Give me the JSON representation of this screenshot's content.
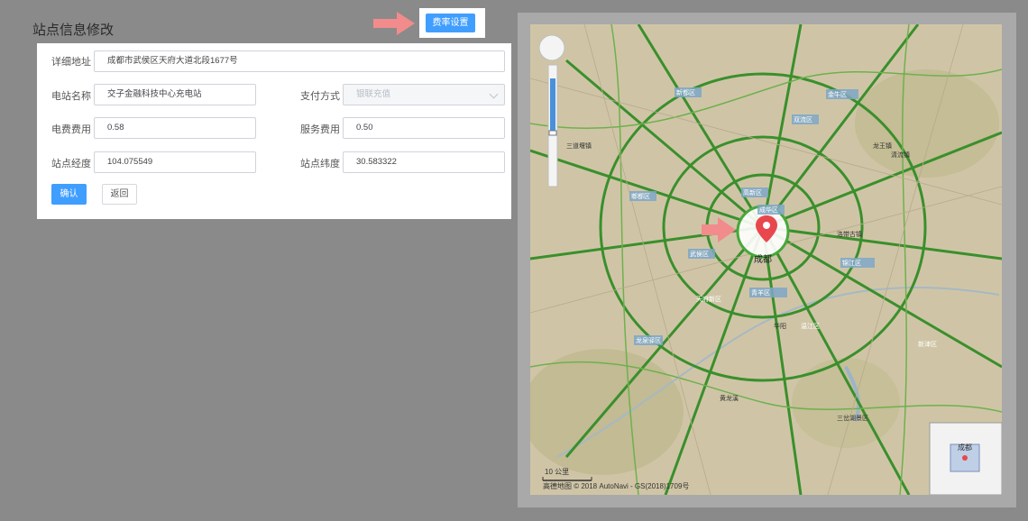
{
  "page": {
    "title": "站点信息修改"
  },
  "toolbar": {
    "rate_button_label": "费率设置"
  },
  "form": {
    "address": {
      "label": "详细地址",
      "value": "成都市武侯区天府大道北段1677号"
    },
    "station_name": {
      "label": "电站名称",
      "value": "交子金融科技中心充电站"
    },
    "payment": {
      "label": "支付方式",
      "value": "银联充值"
    },
    "electricity_fee": {
      "label": "电费费用",
      "value": "0.58"
    },
    "service_fee": {
      "label": "服务费用",
      "value": "0.50"
    },
    "longitude": {
      "label": "站点经度",
      "value": "104.075549"
    },
    "latitude": {
      "label": "站点纬度",
      "value": "30.583322"
    },
    "confirm_label": "确认",
    "back_label": "返回"
  },
  "map": {
    "center_label": "成都",
    "district_labels": [
      "高新区",
      "新都区",
      "郫都区",
      "金牛区",
      "成华区",
      "武侯区",
      "锦江区",
      "青羊区",
      "龙泉驿区",
      "双流区",
      "天府新区",
      "温江区",
      "新津区"
    ],
    "town_labels": [
      "清流镇",
      "三道堰镇",
      "龙王镇",
      "洛带古镇",
      "黄龙溪",
      "三岔湖景区",
      "华阳"
    ],
    "scale_label": "10 公里",
    "copyright": "高德地图 © 2018 AutoNavi - GS(2018)1709号",
    "overview_label": "成都",
    "marker_color": "#e8474d",
    "pointer_color": "#f28b8b"
  }
}
